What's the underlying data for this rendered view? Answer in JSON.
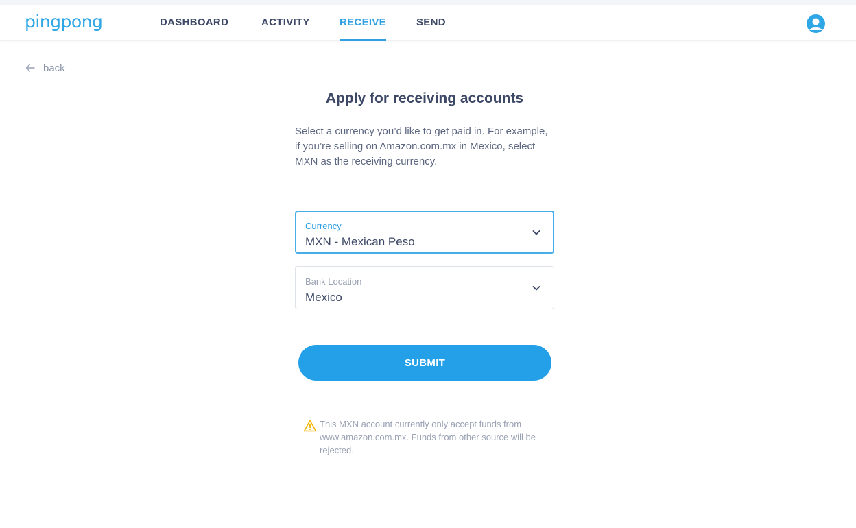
{
  "app": {
    "logo_text": "pingpong",
    "brand_color": "#2fa7e6"
  },
  "nav": {
    "items": [
      {
        "label": "DASHBOARD",
        "active": false
      },
      {
        "label": "ACTIVITY",
        "active": false
      },
      {
        "label": "RECEIVE",
        "active": true
      },
      {
        "label": "SEND",
        "active": false
      }
    ],
    "avatar_icon": "user-avatar-icon"
  },
  "back": {
    "label": "back",
    "icon": "arrow-left-icon"
  },
  "form": {
    "title": "Apply for receiving accounts",
    "description": "Select a currency you’d like to get paid in. For example, if you’re selling on Amazon.com.mx in Mexico, select MXN as the receiving currency.",
    "currency": {
      "label": "Currency",
      "value": "MXN - Mexican Peso",
      "icon": "chevron-down-icon"
    },
    "bank_location": {
      "label": "Bank Location",
      "value": "Mexico",
      "icon": "chevron-down-icon"
    },
    "submit_label": "SUBMIT",
    "notice": {
      "icon": "warning-icon",
      "text": "This MXN account currently only accept funds from www.amazon.com.mx. Funds from other source will be rejected."
    }
  },
  "colors": {
    "accent": "#2fa0e3",
    "button": "#23a0e8",
    "warning": "#f5b400",
    "text_dark": "#3d4866"
  }
}
